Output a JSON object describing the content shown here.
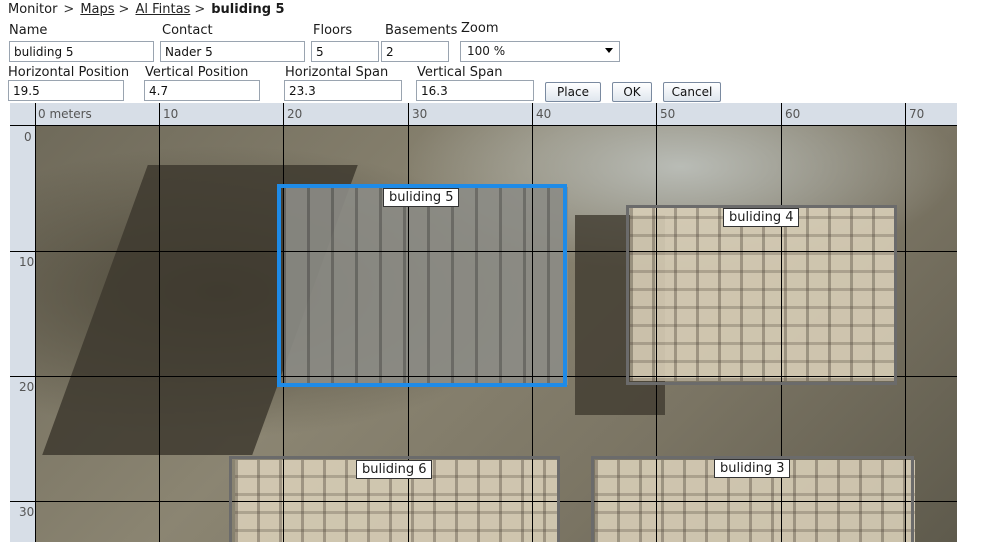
{
  "breadcrumb": {
    "root": "Monitor",
    "maps": "Maps",
    "site": "Al Fintas",
    "current": "buliding 5",
    "separator": ">"
  },
  "form": {
    "name_label": "Name",
    "name_value": "buliding 5",
    "contact_label": "Contact",
    "contact_value": "Nader 5",
    "floors_label": "Floors",
    "floors_value": "5",
    "basements_label": "Basements",
    "basements_value": "2",
    "zoom_label": "Zoom",
    "zoom_value": "100 %",
    "hpos_label": "Horizontal Position",
    "hpos_value": "19.5",
    "vpos_label": "Vertical Position",
    "vpos_value": "4.7",
    "hspan_label": "Horizontal Span",
    "hspan_value": "23.3",
    "vspan_label": "Vertical Span",
    "vspan_value": "16.3"
  },
  "buttons": {
    "place": "Place",
    "ok": "OK",
    "cancel": "Cancel"
  },
  "map": {
    "x_ticks": [
      "0 meters",
      "10",
      "20",
      "30",
      "40",
      "50",
      "60",
      "70"
    ],
    "y_ticks": [
      "0",
      "10",
      "20",
      "30"
    ],
    "buildings": [
      {
        "label": "buliding 5",
        "selected": true
      },
      {
        "label": "buliding 4",
        "selected": false
      },
      {
        "label": "buliding 6",
        "selected": false
      },
      {
        "label": "buliding 3",
        "selected": false
      }
    ],
    "selected_color": "#1e8be8",
    "outline_color": "#6b6b6b"
  }
}
